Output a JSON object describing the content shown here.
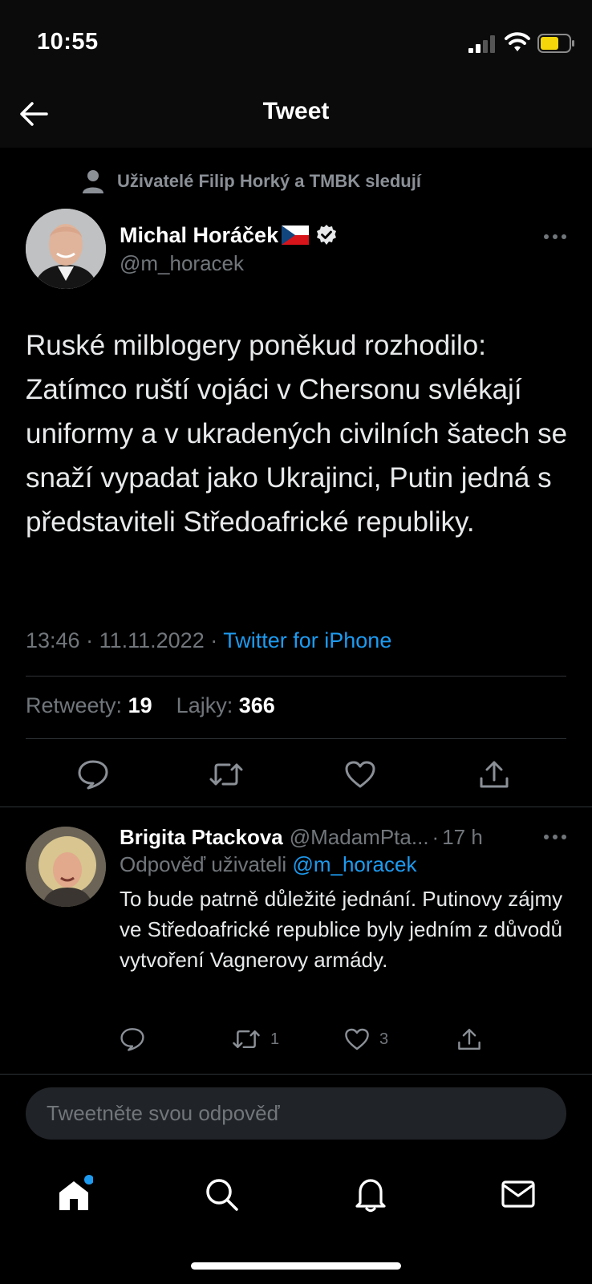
{
  "status_bar": {
    "time": "10:55"
  },
  "header": {
    "title": "Tweet"
  },
  "follow_context": {
    "text": "Uživatelé Filip Horký a TMBK sledují"
  },
  "author": {
    "name": "Michal Horáček",
    "handle": "@m_horacek"
  },
  "tweet": {
    "text": "Ruské milblogery poněkud rozhodilo: Zatímco ruští vojáci v Chersonu svlékají uniformy a v ukradených civilních šatech se snaží vypadat jako Ukrajinci, Putin jedná s představiteli Středoafrické republiky.",
    "time": "13:46",
    "date": "11.11.2022",
    "source": "Twitter for iPhone",
    "retweets_label": "Retweety:",
    "retweets_count": "19",
    "likes_label": "Lajky:",
    "likes_count": "366"
  },
  "reply": {
    "name": "Brigita Ptackova",
    "handle": "@MadamPta...",
    "time": "17 h",
    "reply_to_label": "Odpověď uživateli",
    "reply_to_handle": "@m_horacek",
    "text": "To bude patrně důležité jednání. Putinovy zájmy ve Středoafrické republice byly jedním z důvodů vytvoření Vagnerovy armády.",
    "retweet_count": "1",
    "like_count": "3"
  },
  "compose": {
    "placeholder": "Tweetněte svou odpověď"
  },
  "tab_bar": {
    "items": [
      "home-icon",
      "search-icon",
      "bell-icon",
      "mail-icon"
    ]
  },
  "colors": {
    "accent": "#1d9bf0",
    "secondary_text": "#71767b",
    "background": "#000000"
  }
}
